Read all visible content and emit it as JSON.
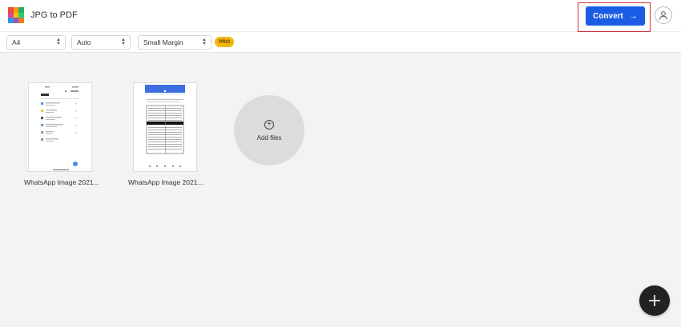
{
  "header": {
    "app_title": "JPG to PDF",
    "convert_label": "Convert",
    "convert_arrow": "→",
    "logo_colors": [
      "#e74c3c",
      "#f39c12",
      "#27ae60",
      "#e84393",
      "#f1c40f",
      "#2ecc71",
      "#3498db",
      "#9b59b6",
      "#e67e22"
    ]
  },
  "toolbar": {
    "page_size": "A4",
    "orientation": "Auto",
    "margin": "Small Margin",
    "pro_badge": "PRO"
  },
  "files": [
    {
      "name": "WhatsApp Image 2021...",
      "preview": "phone-files-screenshot"
    },
    {
      "name": "WhatsApp Image 2021...",
      "preview": "document-form-screenshot"
    }
  ],
  "add_files_label": "Add files",
  "fab_icon": "plus-icon",
  "accent_color": "#1a5de4"
}
